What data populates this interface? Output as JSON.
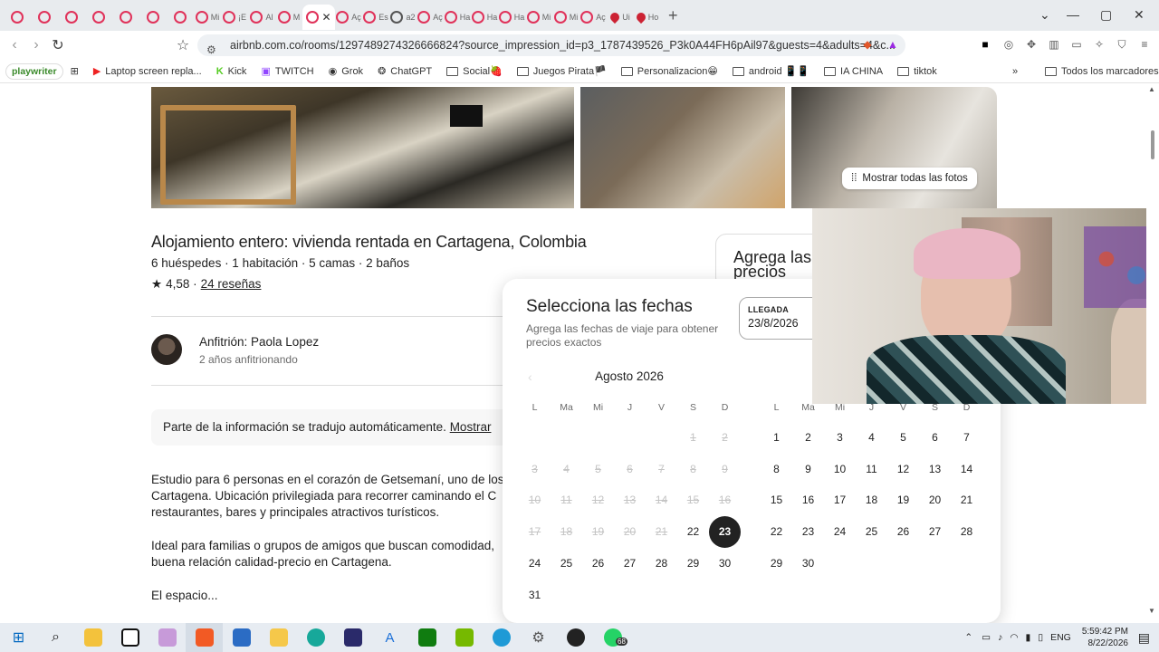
{
  "browser": {
    "tabs": [
      {
        "label": "",
        "icon": "airbnb-icon"
      },
      {
        "label": "",
        "icon": "airbnb-icon"
      },
      {
        "label": "",
        "icon": "airbnb-icon"
      },
      {
        "label": "",
        "icon": "airbnb-icon"
      },
      {
        "label": "",
        "icon": "airbnb-icon"
      },
      {
        "label": "",
        "icon": "airbnb-icon"
      },
      {
        "label": "",
        "icon": "airbnb-icon"
      },
      {
        "label": "Mi",
        "icon": "airbnb-icon"
      },
      {
        "label": "¡E",
        "icon": "airbnb-icon"
      },
      {
        "label": "Al",
        "icon": "airbnb-icon"
      },
      {
        "label": "M",
        "icon": "airbnb-icon"
      },
      {
        "label": "",
        "icon": "airbnb-icon",
        "active": true
      },
      {
        "label": "Aç",
        "icon": "airbnb-icon"
      },
      {
        "label": "Es",
        "icon": "airbnb-icon"
      },
      {
        "label": "a2",
        "icon": "web-icon"
      },
      {
        "label": "Aç",
        "icon": "airbnb-icon"
      },
      {
        "label": "Ha",
        "icon": "airbnb-icon"
      },
      {
        "label": "Ha",
        "icon": "airbnb-icon"
      },
      {
        "label": "Ha",
        "icon": "airbnb-icon"
      },
      {
        "label": "Mi",
        "icon": "airbnb-icon"
      },
      {
        "label": "Mi",
        "icon": "airbnb-icon"
      },
      {
        "label": "Aç",
        "icon": "airbnb-icon"
      },
      {
        "label": "Ui",
        "icon": "maps-icon"
      },
      {
        "label": "Ho",
        "icon": "maps-icon"
      }
    ],
    "url": "airbnb.com.co/rooms/1297489274326666824?source_impression_id=p3_1787439526_P3k0A44FH6pAil97&guests=4&adults=4&c...",
    "bookmarks": [
      {
        "label": "playwriter",
        "type": "badge"
      },
      {
        "label": "Laptop screen repla...",
        "type": "youtube"
      },
      {
        "label": "Kick",
        "type": "link"
      },
      {
        "label": "TWITCH",
        "type": "link"
      },
      {
        "label": "Grok",
        "type": "link"
      },
      {
        "label": "ChatGPT",
        "type": "link"
      },
      {
        "label": "Social🍓",
        "type": "folder"
      },
      {
        "label": "Juegos Pirata🏴",
        "type": "folder"
      },
      {
        "label": "Personalizacion😁",
        "type": "folder"
      },
      {
        "label": "android 📱📱",
        "type": "folder"
      },
      {
        "label": "IA CHINA",
        "type": "folder"
      },
      {
        "label": "tiktok",
        "type": "folder"
      }
    ],
    "all_bookmarks": "Todos los marcadores"
  },
  "listing": {
    "show_all_photos": "Mostrar todas las fotos",
    "title": "Alojamiento entero: vivienda rentada en Cartagena, Colombia",
    "subtitle": "6 huéspedes · 1 habitación · 5 camas · 2 baños",
    "rating_star": "★",
    "rating": "4,58 ·",
    "reviews": "24 reseñas",
    "host_name": "Anfitrión: Paola Lopez",
    "host_years": "2 años anfitrionando",
    "translation_note": "Parte de la información se tradujo automáticamente.",
    "translation_link": "Mostrar",
    "description_1_line1": "Estudio para 6 personas en el corazón de Getsemaní, uno de los",
    "description_1_line2": "Cartagena. Ubicación privilegiada para recorrer caminando el C",
    "description_1_line3": "restaurantes, bares y principales atractivos turísticos.",
    "description_2_line1": "Ideal para familias o grupos de amigos que buscan comodidad,",
    "description_2_line2": "buena relación calidad-precio en Cartagena.",
    "description_3": "El espacio...",
    "side_card": "Agrega las precios"
  },
  "datepicker": {
    "title": "Selecciona las fechas",
    "subtitle": "Agrega las fechas de viaje para obtener precios exactos",
    "checkin_label": "LLEGADA",
    "checkin_value": "23/8/2026",
    "month1": "Agosto 2026",
    "dow": [
      "L",
      "Ma",
      "Mi",
      "J",
      "V",
      "S",
      "D"
    ],
    "month1_days": [
      "1",
      "2",
      "3",
      "4",
      "5",
      "6",
      "7",
      "8",
      "9",
      "10",
      "11",
      "12",
      "13",
      "14",
      "15",
      "16",
      "17",
      "18",
      "19",
      "20",
      "21",
      "22",
      "23",
      "24",
      "25",
      "26",
      "27",
      "28",
      "29",
      "30",
      "31"
    ],
    "month1_start_col": 5,
    "month1_past_through": 21,
    "selected_day": "23",
    "month2_days": [
      "1",
      "2",
      "3",
      "4",
      "5",
      "6",
      "7",
      "8",
      "9",
      "10",
      "11",
      "12",
      "13",
      "14",
      "15",
      "16",
      "17",
      "18",
      "19",
      "20",
      "21",
      "22",
      "23",
      "24",
      "25",
      "26",
      "27",
      "28",
      "29",
      "30"
    ],
    "month2_start_col": 0
  },
  "taskbar": {
    "whatsapp_badge": "68",
    "lang": "ENG",
    "time": "5:59:42 PM",
    "date": "8/22/2026"
  },
  "colors": {
    "accent": "#e0325a",
    "selected": "#222222"
  }
}
